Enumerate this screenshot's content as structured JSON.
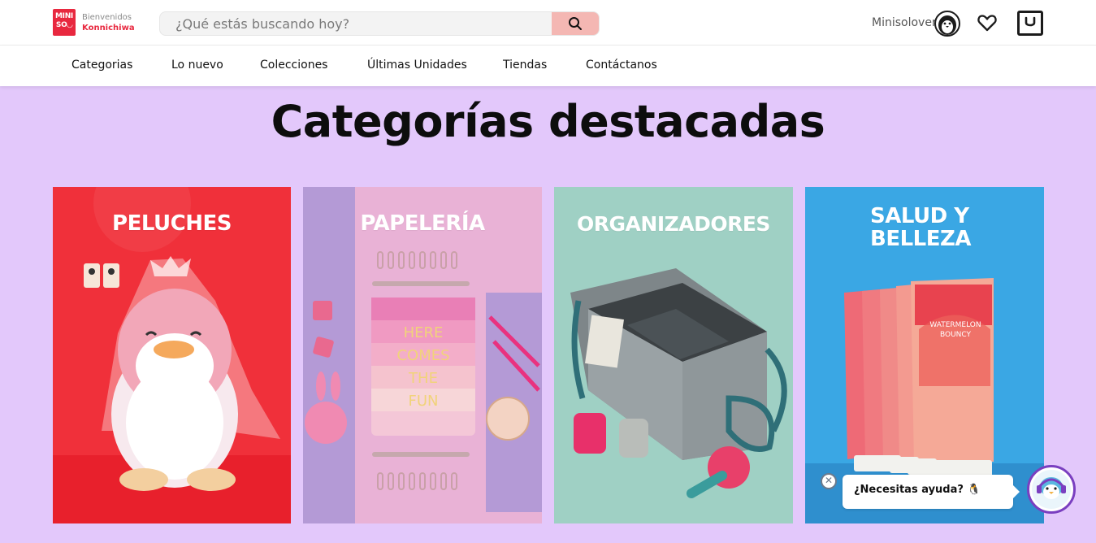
{
  "header": {
    "logo": {
      "line1": "MINI",
      "line2": "SO",
      "face": "◡"
    },
    "welcome": {
      "line1": "Bienvenidos",
      "line2": "Konnichiwa"
    },
    "search": {
      "placeholder": "¿Qué estás buscando hoy?",
      "value": "",
      "button_icon": "search-icon"
    },
    "user_name": "Minisolover",
    "icons": [
      "penguin-avatar-icon",
      "heart-icon",
      "shopping-bag-icon"
    ]
  },
  "nav": {
    "items": [
      {
        "label": "Categorias"
      },
      {
        "label": "Lo nuevo"
      },
      {
        "label": "Colecciones"
      },
      {
        "label": "Últimas Unidades"
      },
      {
        "label": "Tiendas"
      },
      {
        "label": "Contáctanos"
      }
    ]
  },
  "main": {
    "title": "Categorías destacadas",
    "background": "#e3c8fb",
    "categories": [
      {
        "line1": "PELUCHES",
        "line2": "",
        "bg": "#f0303a"
      },
      {
        "line1": "PAPELERÍA",
        "line2": "",
        "bg": "#e9b2d6",
        "notebook_text": [
          "HERE",
          "COMES",
          "THE",
          "FUN"
        ]
      },
      {
        "line1": "ORGANIZADORES",
        "line2": "",
        "bg": "#9fd0c4"
      },
      {
        "line1": "SALUD Y",
        "line2": "BELLEZA",
        "bg": "#3aa7e4",
        "product_text": [
          "WATERMELON",
          "BOUNCY"
        ]
      }
    ]
  },
  "chat": {
    "close_symbol": "✕",
    "message": "¿Necesitas ayuda? 🐧",
    "accent": "#7a3fc0"
  }
}
